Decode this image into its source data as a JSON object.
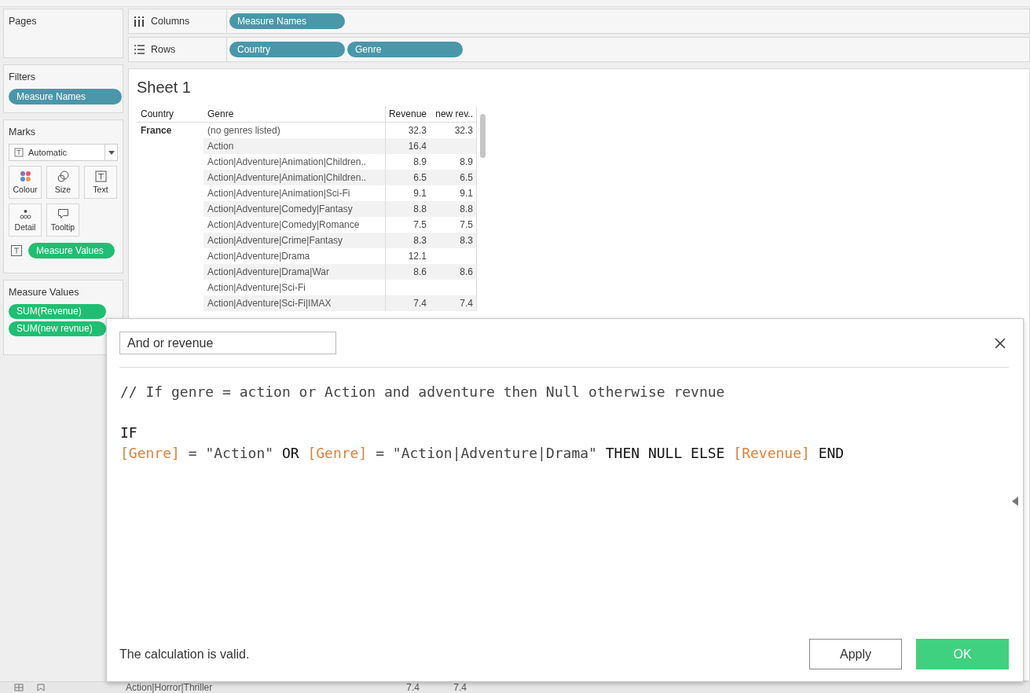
{
  "sidebar": {
    "pages": {
      "title": "Pages"
    },
    "filters": {
      "title": "Filters",
      "pills": [
        "Measure Names"
      ]
    },
    "marks": {
      "title": "Marks",
      "mark_type": "Automatic",
      "cards": [
        {
          "label": "Colour",
          "kind": "colour"
        },
        {
          "label": "Size",
          "kind": "size"
        },
        {
          "label": "Text",
          "kind": "text"
        },
        {
          "label": "Detail",
          "kind": "detail"
        },
        {
          "label": "Tooltip",
          "kind": "tooltip"
        }
      ],
      "pill": "Measure Values"
    },
    "measure_values": {
      "title": "Measure Values",
      "pills": [
        "SUM(Revenue)",
        "SUM(new revnue)"
      ]
    }
  },
  "shelves": [
    {
      "label": "Columns",
      "kind": "columns",
      "pills": [
        "Measure Names"
      ]
    },
    {
      "label": "Rows",
      "kind": "rows",
      "pills": [
        "Country",
        "Genre"
      ]
    }
  ],
  "sheet": {
    "title": "Sheet 1",
    "columns": [
      "Country",
      "Genre",
      "Revenue",
      "new rev.."
    ],
    "rows": [
      {
        "country": "France",
        "genre": "(no genres listed)",
        "revenue": "32.3",
        "new_revenue": "32.3"
      },
      {
        "genre": "Action",
        "revenue": "16.4"
      },
      {
        "genre": "Action|Adventure|Animation|Children..",
        "revenue": "8.9",
        "new_revenue": "8.9"
      },
      {
        "genre": "Action|Adventure|Animation|Children..",
        "revenue": "6.5",
        "new_revenue": "6.5"
      },
      {
        "genre": "Action|Adventure|Animation|Sci-Fi",
        "revenue": "9.1",
        "new_revenue": "9.1"
      },
      {
        "genre": "Action|Adventure|Comedy|Fantasy",
        "revenue": "8.8",
        "new_revenue": "8.8"
      },
      {
        "genre": "Action|Adventure|Comedy|Romance",
        "revenue": "7.5",
        "new_revenue": "7.5"
      },
      {
        "genre": "Action|Adventure|Crime|Fantasy",
        "revenue": "8.3",
        "new_revenue": "8.3"
      },
      {
        "genre": "Action|Adventure|Drama",
        "revenue": "12.1"
      },
      {
        "genre": "Action|Adventure|Drama|War",
        "revenue": "8.6",
        "new_revenue": "8.6"
      },
      {
        "genre": "Action|Adventure|Sci-Fi"
      },
      {
        "genre": "Action|Adventure|Sci-Fi|IMAX",
        "revenue": "7.4",
        "new_revenue": "7.4"
      }
    ],
    "bottom_row": {
      "genre": "Action|Horror|Thriller",
      "revenue": "7.4",
      "new_revenue": "7.4"
    }
  },
  "dialog": {
    "name": "And or revenue",
    "comment": "// If genre = action or Action and adventure then Null otherwise revnue",
    "lines": [
      [
        {
          "kind": "keyword",
          "text": "IF"
        }
      ],
      [
        {
          "kind": "field",
          "text": "[Genre]"
        },
        {
          "kind": "op",
          "text": " = "
        },
        {
          "kind": "string",
          "text": "\"Action\""
        },
        {
          "kind": "keyword",
          "text": " OR "
        },
        {
          "kind": "field",
          "text": "[Genre]"
        },
        {
          "kind": "op",
          "text": " = "
        },
        {
          "kind": "string",
          "text": "\"Action|Adventure|Drama\""
        },
        {
          "kind": "keyword",
          "text": " THEN NULL ELSE "
        },
        {
          "kind": "field",
          "text": "[Revenue]"
        },
        {
          "kind": "keyword",
          "text": " END"
        }
      ]
    ],
    "status": "The calculation is valid.",
    "buttons": [
      {
        "label": "Apply",
        "kind": "secondary"
      },
      {
        "label": "OK",
        "kind": "primary"
      }
    ]
  }
}
